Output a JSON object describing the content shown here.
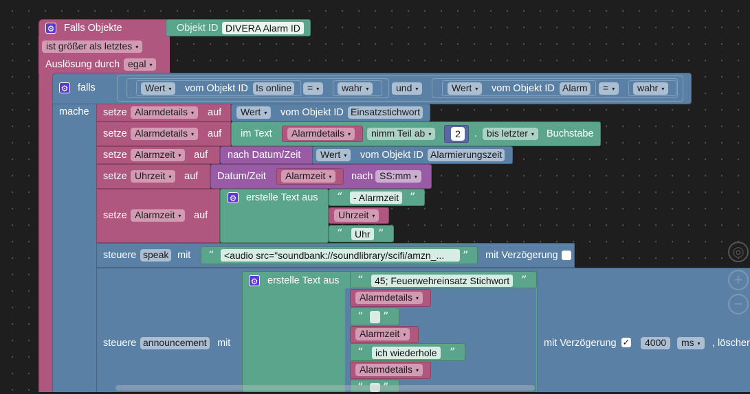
{
  "event": {
    "title": "Falls Objekte",
    "objekt_label": "Objekt ID",
    "objekt_value": "DIVERA Alarm ID",
    "condition": "ist größer als letztes",
    "trigger_label": "Auslösung durch",
    "trigger_value": "egal"
  },
  "if_block": {
    "falls": "falls",
    "mache": "mache",
    "cond1": {
      "wert": "Wert",
      "vom": "vom Objekt ID",
      "obj": "Is online",
      "op": "=",
      "val": "wahr"
    },
    "and_label": "und",
    "cond2": {
      "wert": "Wert",
      "vom": "vom Objekt ID",
      "obj": "Alarm",
      "op": "=",
      "val": "wahr"
    }
  },
  "row1": {
    "setze": "setze",
    "var": "Alarmdetails",
    "auf": "auf",
    "wert": "Wert",
    "vom": "vom Objekt ID",
    "obj": "Einsatzstichwort"
  },
  "row2": {
    "setze": "setze",
    "var": "Alarmdetails",
    "auf": "auf",
    "im_text": "im Text",
    "var2": "Alarmdetails",
    "teil": "nimm Teil ab",
    "num": "2",
    "dot": ".",
    "bis": "bis letzter",
    "buchstabe": "Buchstabe"
  },
  "row3": {
    "setze": "setze",
    "var": "Alarmzeit",
    "auf": "auf",
    "nach": "nach Datum/Zeit",
    "wert": "Wert",
    "vom": "vom Objekt ID",
    "obj": "Alarmierungszeit"
  },
  "row4": {
    "setze": "setze",
    "var": "Uhrzeit",
    "auf": "auf",
    "datum": "Datum/Zeit",
    "var2": "Alarmzeit",
    "nach": "nach",
    "fmt": "SS:mm"
  },
  "row5": {
    "setze": "setze",
    "var": "Alarmzeit",
    "auf": "auf",
    "erstelle": "erstelle Text aus",
    "s1": "- Alarmzeit",
    "v1": "Uhrzeit",
    "s2": "Uhr"
  },
  "speak": {
    "steuere": "steuere",
    "target": "speak",
    "mit": "mit",
    "text": "<audio src=\"soundbank://soundlibrary/scifi/amzn_...",
    "verz": "mit Verzögerung"
  },
  "announce": {
    "steuere": "steuere",
    "target": "announcement",
    "mit": "mit",
    "erstelle": "erstelle Text aus",
    "s1": "45; Feuerwehreinsatz Stichwort",
    "v1": "Alarmdetails",
    "v2": "Alarmzeit",
    "s3": "ich wiederhole",
    "v3": "Alarmdetails",
    "verz": "mit Verzögerung",
    "check": "✓",
    "delay": "4000",
    "unit": "ms",
    "tail": ", löscher"
  },
  "quote_open": "“",
  "quote_close": "”",
  "arrow": "▾",
  "gear": "⚙",
  "controls": {
    "zoom_in": "+",
    "zoom_out": "−",
    "center": "◎"
  },
  "colors": {
    "event": "#b0577f",
    "logic": "#5b80a5",
    "text": "#5ba58c",
    "time": "#995ba5",
    "math": "#5b67a5"
  }
}
